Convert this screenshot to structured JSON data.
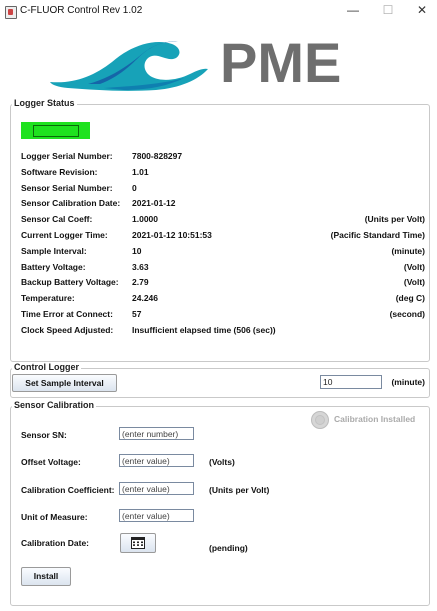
{
  "window": {
    "title": "C-FLUOR Control Rev 1.02"
  },
  "logo": {
    "text": "PME"
  },
  "logger_status": {
    "title": "Logger Status",
    "rows": [
      {
        "label": "Logger Serial Number:",
        "value": "7800-828297",
        "unit": ""
      },
      {
        "label": "Software Revision:",
        "value": "1.01",
        "unit": ""
      },
      {
        "label": "Sensor Serial Number:",
        "value": "0",
        "unit": ""
      },
      {
        "label": "Sensor Calibration Date:",
        "value": "2021-01-12",
        "unit": ""
      },
      {
        "label": "Sensor Cal Coeff:",
        "value": "1.0000",
        "unit": "(Units per Volt)"
      },
      {
        "label": "Current Logger Time:",
        "value": "2021-01-12 10:51:53",
        "unit": "(Pacific Standard Time)"
      },
      {
        "label": "Sample Interval:",
        "value": "10",
        "unit": "(minute)"
      },
      {
        "label": "Battery Voltage:",
        "value": "3.63",
        "unit": "(Volt)"
      },
      {
        "label": "Backup Battery Voltage:",
        "value": "2.79",
        "unit": "(Volt)"
      },
      {
        "label": "Temperature:",
        "value": "24.246",
        "unit": "(deg C)"
      },
      {
        "label": "Time Error at Connect:",
        "value": "57",
        "unit": "(second)"
      },
      {
        "label": "Clock Speed Adjusted:",
        "value": "Insufficient elapsed time (506 (sec))",
        "unit": ""
      }
    ],
    "status_color": "#1fe21f"
  },
  "control_logger": {
    "title": "Control Logger",
    "set_button": "Set Sample Interval",
    "interval_value": "10",
    "interval_unit": "(minute)"
  },
  "sensor_calibration": {
    "title": "Sensor Calibration",
    "installed_label": "Calibration Installed",
    "sensor_sn_label": "Sensor SN:",
    "sensor_sn_placeholder": "(enter number)",
    "offset_label": "Offset Voltage:",
    "offset_placeholder": "(enter value)",
    "offset_unit": "(Volts)",
    "coeff_label": "Calibration Coefficient:",
    "coeff_placeholder": "(enter value)",
    "coeff_unit": "(Units per Volt)",
    "uom_label": "Unit of Measure:",
    "uom_placeholder": "(enter value)",
    "date_label": "Calibration Date:",
    "date_status": "(pending)",
    "install_button": "Install"
  },
  "colors": {
    "logo_teal": "#17a2b8",
    "logo_blue": "#1565a8",
    "logo_gray": "#6e6e6e"
  }
}
